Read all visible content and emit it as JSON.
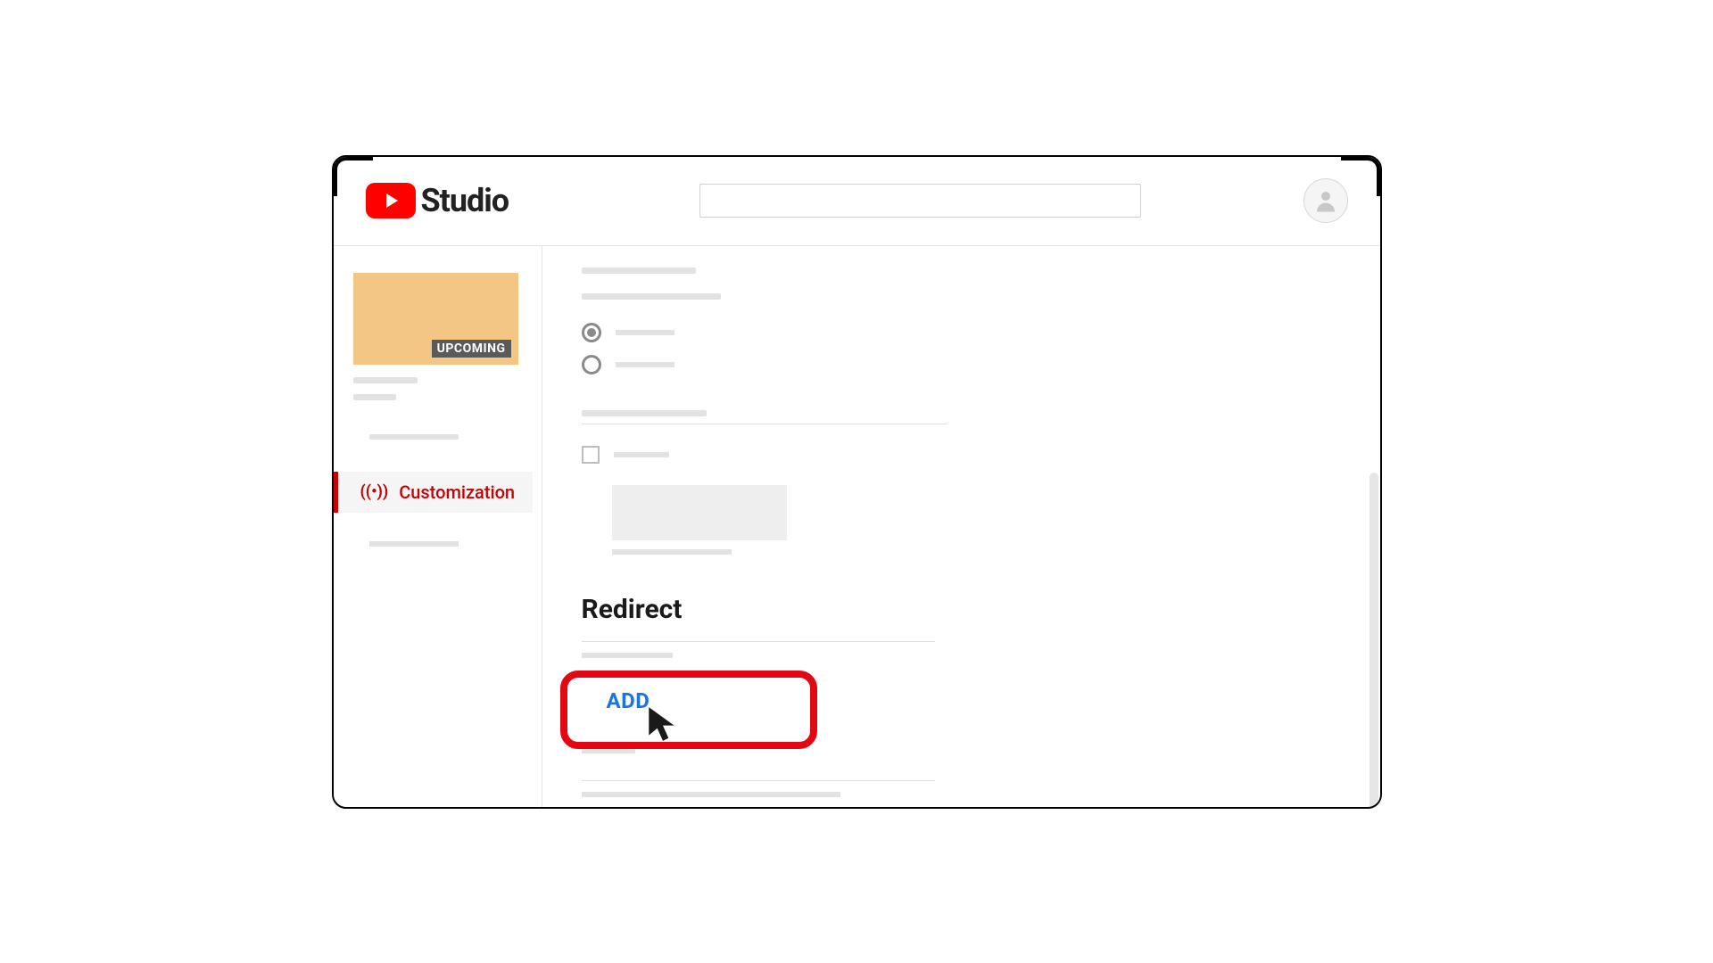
{
  "header": {
    "logo_text": "Studio"
  },
  "sidebar": {
    "thumbnail_badge": "UPCOMING",
    "active_nav_label": "Customization"
  },
  "main": {
    "section_title": "Redirect",
    "add_button_label": "ADD"
  },
  "colors": {
    "brand": "#ff0000",
    "accent": "#cc0000",
    "link": "#1a73e8",
    "highlight": "#e30613"
  }
}
